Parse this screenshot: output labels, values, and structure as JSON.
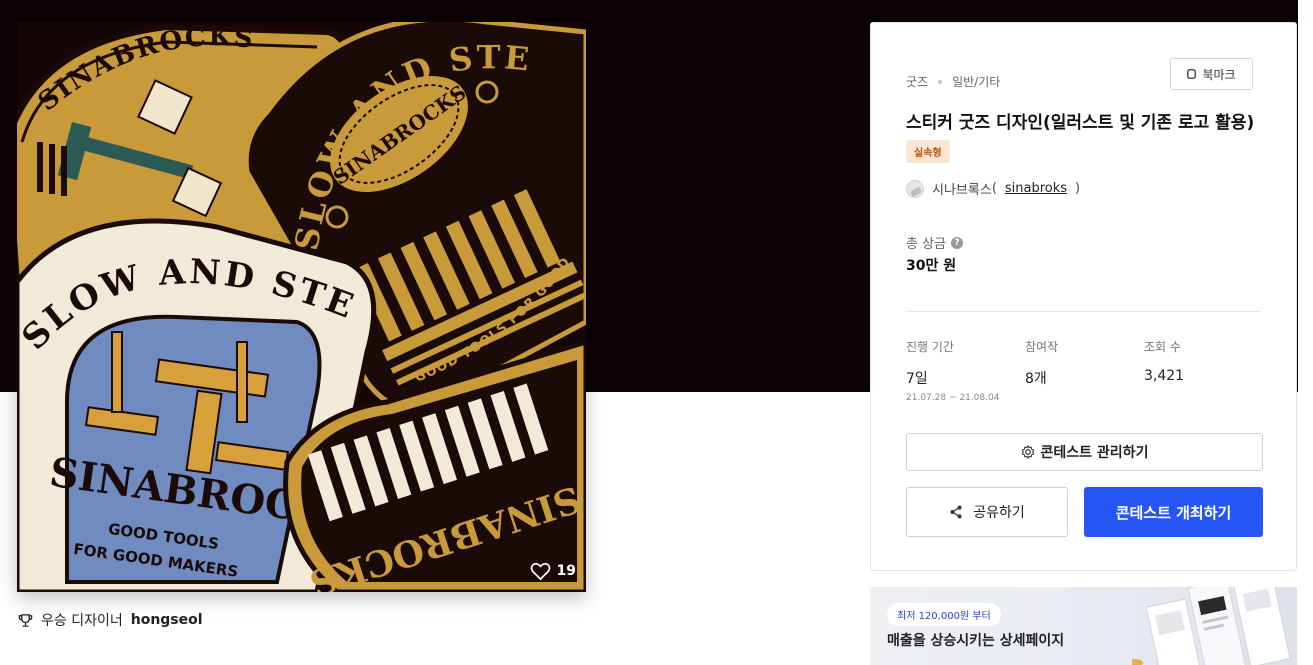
{
  "hero": {
    "art_text": {
      "top_sticker": "SINABROCKS",
      "slow_and_steady": "SLOW AND STEADY",
      "good_tools": "GOOD TOOLS FOR GOOD MAKERS",
      "blue_sticker_brand": "SINABROCKS",
      "blue_sticker_line1": "GOOD TOOLS",
      "blue_sticker_line2": "FOR GOOD MAKERS",
      "dark_sticker_brand": "SINABROCKS",
      "diamond_text": "SLOW AND STEADY"
    },
    "like_count": "19"
  },
  "winner": {
    "label": "우승 디자이너",
    "name": "hongseol"
  },
  "panel": {
    "category": "굿즈",
    "subcategory": "일반/기타",
    "bookmark_label": "북마크",
    "title": "스티커 굿즈 디자인(일러스트 및 기존 로고 활용)",
    "tag": "실속형",
    "host_name": "시나브록스",
    "host_id": "sinabroks",
    "prize_label": "총 상금",
    "prize_value": "30만 원",
    "stats": [
      {
        "label": "진행 기간",
        "value": "7일",
        "sub": "21.07.28 ~ 21.08.04"
      },
      {
        "label": "참여작",
        "value": "8개",
        "sub": ""
      },
      {
        "label": "조회 수",
        "value": "3,421",
        "sub": ""
      }
    ],
    "manage_label": "콘테스트 관리하기",
    "share_label": "공유하기",
    "host_contest_label": "콘테스트 개최하기"
  },
  "banner": {
    "pill": "최저 120,000원 부터",
    "text": "매출을 상승시키는 상세페이지"
  },
  "colors": {
    "top_band": "#0c0103",
    "accent_blue": "#2556f5",
    "sticker_gold": "#c99a3a",
    "sticker_dark": "#1a0a08",
    "sticker_blue": "#6f8bc0",
    "tag_bg": "#fbe6d4"
  }
}
